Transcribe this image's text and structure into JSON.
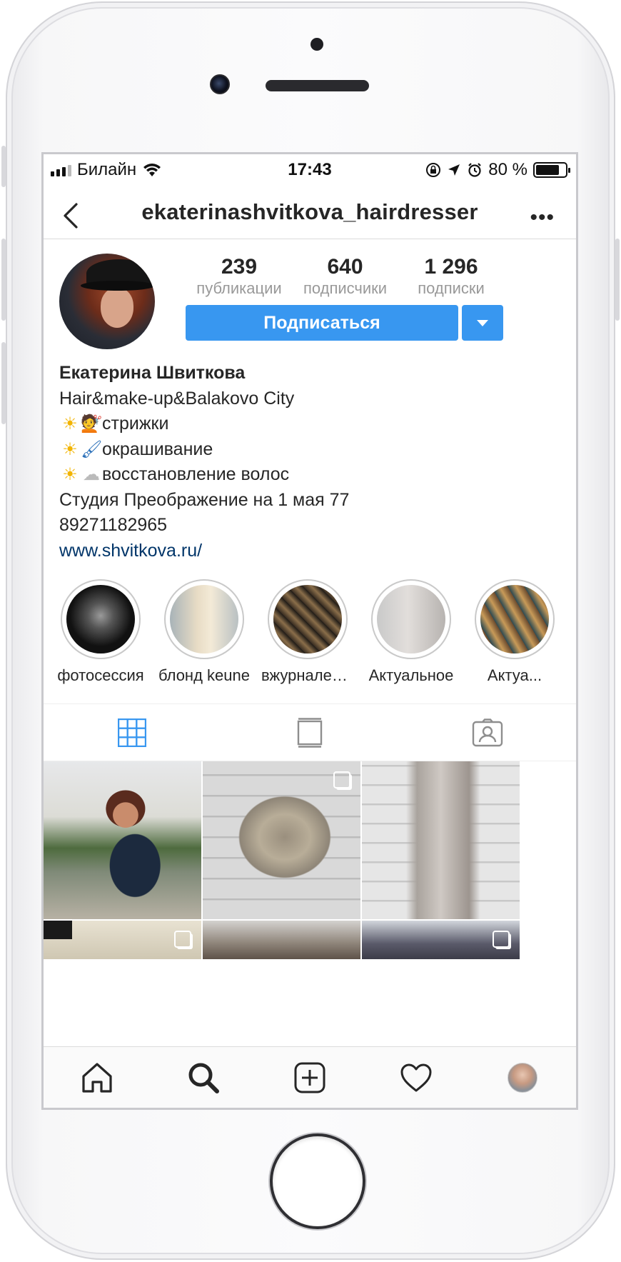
{
  "status_bar": {
    "carrier": "Билайн",
    "time": "17:43",
    "battery_percent": "80 %",
    "battery_level": 0.8
  },
  "nav": {
    "title": "ekaterinashvitkova_hairdresser"
  },
  "profile": {
    "stats": [
      {
        "value": "239",
        "label": "публикации"
      },
      {
        "value": "640",
        "label": "подписчики"
      },
      {
        "value": "1 296",
        "label": "подписки"
      }
    ],
    "follow_label": "Подписаться"
  },
  "bio": {
    "name": "Екатерина Швиткова",
    "line1": "Hair&make-up&Balakovo City",
    "line2": "стрижки",
    "line3": "окрашивание",
    "line4": "восстановление волос",
    "line5": "Студия Преображение на 1 мая 77",
    "phone": "89271182965",
    "link": "www.shvitkova.ru/"
  },
  "highlights": [
    {
      "label": "фотосессия"
    },
    {
      "label": "блонд keune"
    },
    {
      "label": "вжурналеS..."
    },
    {
      "label": "Актуальное"
    },
    {
      "label": "Актуа..."
    }
  ],
  "tabs": [
    "grid-icon",
    "feed-icon",
    "tagged-icon"
  ],
  "bottom_tabs": [
    "home-icon",
    "search-icon",
    "new-post-icon",
    "activity-heart-icon",
    "profile-avatar"
  ],
  "colors": {
    "accent": "#3897f0",
    "link": "#003569"
  }
}
